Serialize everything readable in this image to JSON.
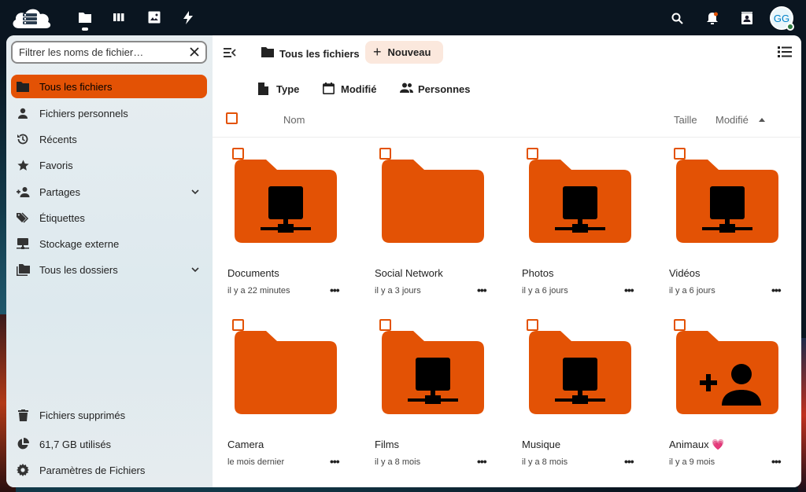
{
  "topbar": {
    "apps": [
      {
        "name": "files-app-icon"
      },
      {
        "name": "deck-app-icon"
      },
      {
        "name": "photos-app-icon"
      },
      {
        "name": "activity-app-icon"
      }
    ],
    "avatar_initials": "GG"
  },
  "sidebar": {
    "filter_placeholder": "Filtrer les noms de fichier…",
    "items": [
      {
        "label": "Tous les fichiers",
        "icon": "folder-icon",
        "active": true
      },
      {
        "label": "Fichiers personnels",
        "icon": "account-icon"
      },
      {
        "label": "Récents",
        "icon": "history-icon"
      },
      {
        "label": "Favoris",
        "icon": "star-icon"
      },
      {
        "label": "Partages",
        "icon": "account-plus-icon",
        "expandable": true
      },
      {
        "label": "Étiquettes",
        "icon": "tag-icon"
      },
      {
        "label": "Stockage externe",
        "icon": "network-icon"
      },
      {
        "label": "Tous les dossiers",
        "icon": "folder-multiple-icon",
        "expandable": true
      }
    ],
    "footer": [
      {
        "label": "Fichiers supprimés",
        "icon": "trash-icon"
      },
      {
        "label": "61,7 GB utilisés",
        "icon": "chart-pie-icon"
      },
      {
        "label": "Paramètres de Fichiers",
        "icon": "cog-icon"
      }
    ]
  },
  "main": {
    "breadcrumb": "Tous les fichiers",
    "new_label": "Nouveau",
    "filters": {
      "type": "Type",
      "modified": "Modifié",
      "people": "Personnes"
    },
    "columns": {
      "name": "Nom",
      "size": "Taille",
      "modified": "Modifié"
    },
    "accent": "#e35205",
    "files": [
      {
        "name": "Documents",
        "time": "il y a 22 minutes",
        "kind": "external"
      },
      {
        "name": "Social Network",
        "time": "il y a 3 jours",
        "kind": "plain"
      },
      {
        "name": "Photos",
        "time": "il y a 6 jours",
        "kind": "external"
      },
      {
        "name": "Vidéos",
        "time": "il y a 6 jours",
        "kind": "external"
      },
      {
        "name": "Camera",
        "time": "le mois dernier",
        "kind": "plain"
      },
      {
        "name": "Films",
        "time": "il y a 8 mois",
        "kind": "external"
      },
      {
        "name": "Musique",
        "time": "il y a 8 mois",
        "kind": "external"
      },
      {
        "name": "Animaux 💗",
        "time": "il y a 9 mois",
        "kind": "shared"
      }
    ]
  }
}
